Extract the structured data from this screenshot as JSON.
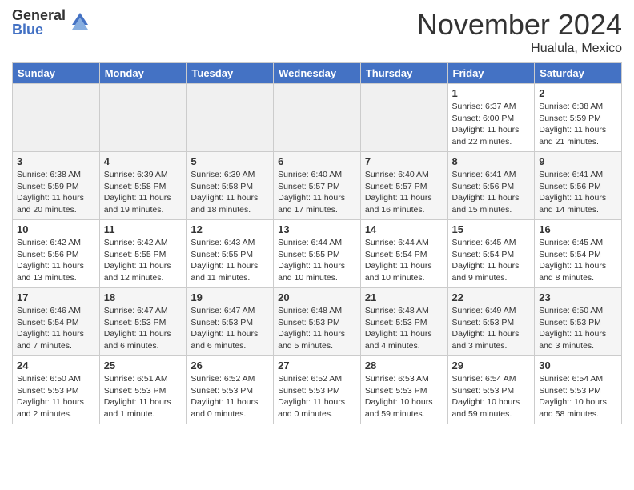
{
  "logo": {
    "general": "General",
    "blue": "Blue"
  },
  "header": {
    "month": "November 2024",
    "location": "Hualula, Mexico"
  },
  "weekdays": [
    "Sunday",
    "Monday",
    "Tuesday",
    "Wednesday",
    "Thursday",
    "Friday",
    "Saturday"
  ],
  "weeks": [
    [
      {
        "day": "",
        "empty": true
      },
      {
        "day": "",
        "empty": true
      },
      {
        "day": "",
        "empty": true
      },
      {
        "day": "",
        "empty": true
      },
      {
        "day": "",
        "empty": true
      },
      {
        "day": "1",
        "sunrise": "Sunrise: 6:37 AM",
        "sunset": "Sunset: 6:00 PM",
        "daylight": "Daylight: 11 hours and 22 minutes."
      },
      {
        "day": "2",
        "sunrise": "Sunrise: 6:38 AM",
        "sunset": "Sunset: 5:59 PM",
        "daylight": "Daylight: 11 hours and 21 minutes."
      }
    ],
    [
      {
        "day": "3",
        "sunrise": "Sunrise: 6:38 AM",
        "sunset": "Sunset: 5:59 PM",
        "daylight": "Daylight: 11 hours and 20 minutes."
      },
      {
        "day": "4",
        "sunrise": "Sunrise: 6:39 AM",
        "sunset": "Sunset: 5:58 PM",
        "daylight": "Daylight: 11 hours and 19 minutes."
      },
      {
        "day": "5",
        "sunrise": "Sunrise: 6:39 AM",
        "sunset": "Sunset: 5:58 PM",
        "daylight": "Daylight: 11 hours and 18 minutes."
      },
      {
        "day": "6",
        "sunrise": "Sunrise: 6:40 AM",
        "sunset": "Sunset: 5:57 PM",
        "daylight": "Daylight: 11 hours and 17 minutes."
      },
      {
        "day": "7",
        "sunrise": "Sunrise: 6:40 AM",
        "sunset": "Sunset: 5:57 PM",
        "daylight": "Daylight: 11 hours and 16 minutes."
      },
      {
        "day": "8",
        "sunrise": "Sunrise: 6:41 AM",
        "sunset": "Sunset: 5:56 PM",
        "daylight": "Daylight: 11 hours and 15 minutes."
      },
      {
        "day": "9",
        "sunrise": "Sunrise: 6:41 AM",
        "sunset": "Sunset: 5:56 PM",
        "daylight": "Daylight: 11 hours and 14 minutes."
      }
    ],
    [
      {
        "day": "10",
        "sunrise": "Sunrise: 6:42 AM",
        "sunset": "Sunset: 5:56 PM",
        "daylight": "Daylight: 11 hours and 13 minutes."
      },
      {
        "day": "11",
        "sunrise": "Sunrise: 6:42 AM",
        "sunset": "Sunset: 5:55 PM",
        "daylight": "Daylight: 11 hours and 12 minutes."
      },
      {
        "day": "12",
        "sunrise": "Sunrise: 6:43 AM",
        "sunset": "Sunset: 5:55 PM",
        "daylight": "Daylight: 11 hours and 11 minutes."
      },
      {
        "day": "13",
        "sunrise": "Sunrise: 6:44 AM",
        "sunset": "Sunset: 5:55 PM",
        "daylight": "Daylight: 11 hours and 10 minutes."
      },
      {
        "day": "14",
        "sunrise": "Sunrise: 6:44 AM",
        "sunset": "Sunset: 5:54 PM",
        "daylight": "Daylight: 11 hours and 10 minutes."
      },
      {
        "day": "15",
        "sunrise": "Sunrise: 6:45 AM",
        "sunset": "Sunset: 5:54 PM",
        "daylight": "Daylight: 11 hours and 9 minutes."
      },
      {
        "day": "16",
        "sunrise": "Sunrise: 6:45 AM",
        "sunset": "Sunset: 5:54 PM",
        "daylight": "Daylight: 11 hours and 8 minutes."
      }
    ],
    [
      {
        "day": "17",
        "sunrise": "Sunrise: 6:46 AM",
        "sunset": "Sunset: 5:54 PM",
        "daylight": "Daylight: 11 hours and 7 minutes."
      },
      {
        "day": "18",
        "sunrise": "Sunrise: 6:47 AM",
        "sunset": "Sunset: 5:53 PM",
        "daylight": "Daylight: 11 hours and 6 minutes."
      },
      {
        "day": "19",
        "sunrise": "Sunrise: 6:47 AM",
        "sunset": "Sunset: 5:53 PM",
        "daylight": "Daylight: 11 hours and 6 minutes."
      },
      {
        "day": "20",
        "sunrise": "Sunrise: 6:48 AM",
        "sunset": "Sunset: 5:53 PM",
        "daylight": "Daylight: 11 hours and 5 minutes."
      },
      {
        "day": "21",
        "sunrise": "Sunrise: 6:48 AM",
        "sunset": "Sunset: 5:53 PM",
        "daylight": "Daylight: 11 hours and 4 minutes."
      },
      {
        "day": "22",
        "sunrise": "Sunrise: 6:49 AM",
        "sunset": "Sunset: 5:53 PM",
        "daylight": "Daylight: 11 hours and 3 minutes."
      },
      {
        "day": "23",
        "sunrise": "Sunrise: 6:50 AM",
        "sunset": "Sunset: 5:53 PM",
        "daylight": "Daylight: 11 hours and 3 minutes."
      }
    ],
    [
      {
        "day": "24",
        "sunrise": "Sunrise: 6:50 AM",
        "sunset": "Sunset: 5:53 PM",
        "daylight": "Daylight: 11 hours and 2 minutes."
      },
      {
        "day": "25",
        "sunrise": "Sunrise: 6:51 AM",
        "sunset": "Sunset: 5:53 PM",
        "daylight": "Daylight: 11 hours and 1 minute."
      },
      {
        "day": "26",
        "sunrise": "Sunrise: 6:52 AM",
        "sunset": "Sunset: 5:53 PM",
        "daylight": "Daylight: 11 hours and 0 minutes."
      },
      {
        "day": "27",
        "sunrise": "Sunrise: 6:52 AM",
        "sunset": "Sunset: 5:53 PM",
        "daylight": "Daylight: 11 hours and 0 minutes."
      },
      {
        "day": "28",
        "sunrise": "Sunrise: 6:53 AM",
        "sunset": "Sunset: 5:53 PM",
        "daylight": "Daylight: 10 hours and 59 minutes."
      },
      {
        "day": "29",
        "sunrise": "Sunrise: 6:54 AM",
        "sunset": "Sunset: 5:53 PM",
        "daylight": "Daylight: 10 hours and 59 minutes."
      },
      {
        "day": "30",
        "sunrise": "Sunrise: 6:54 AM",
        "sunset": "Sunset: 5:53 PM",
        "daylight": "Daylight: 10 hours and 58 minutes."
      }
    ]
  ]
}
